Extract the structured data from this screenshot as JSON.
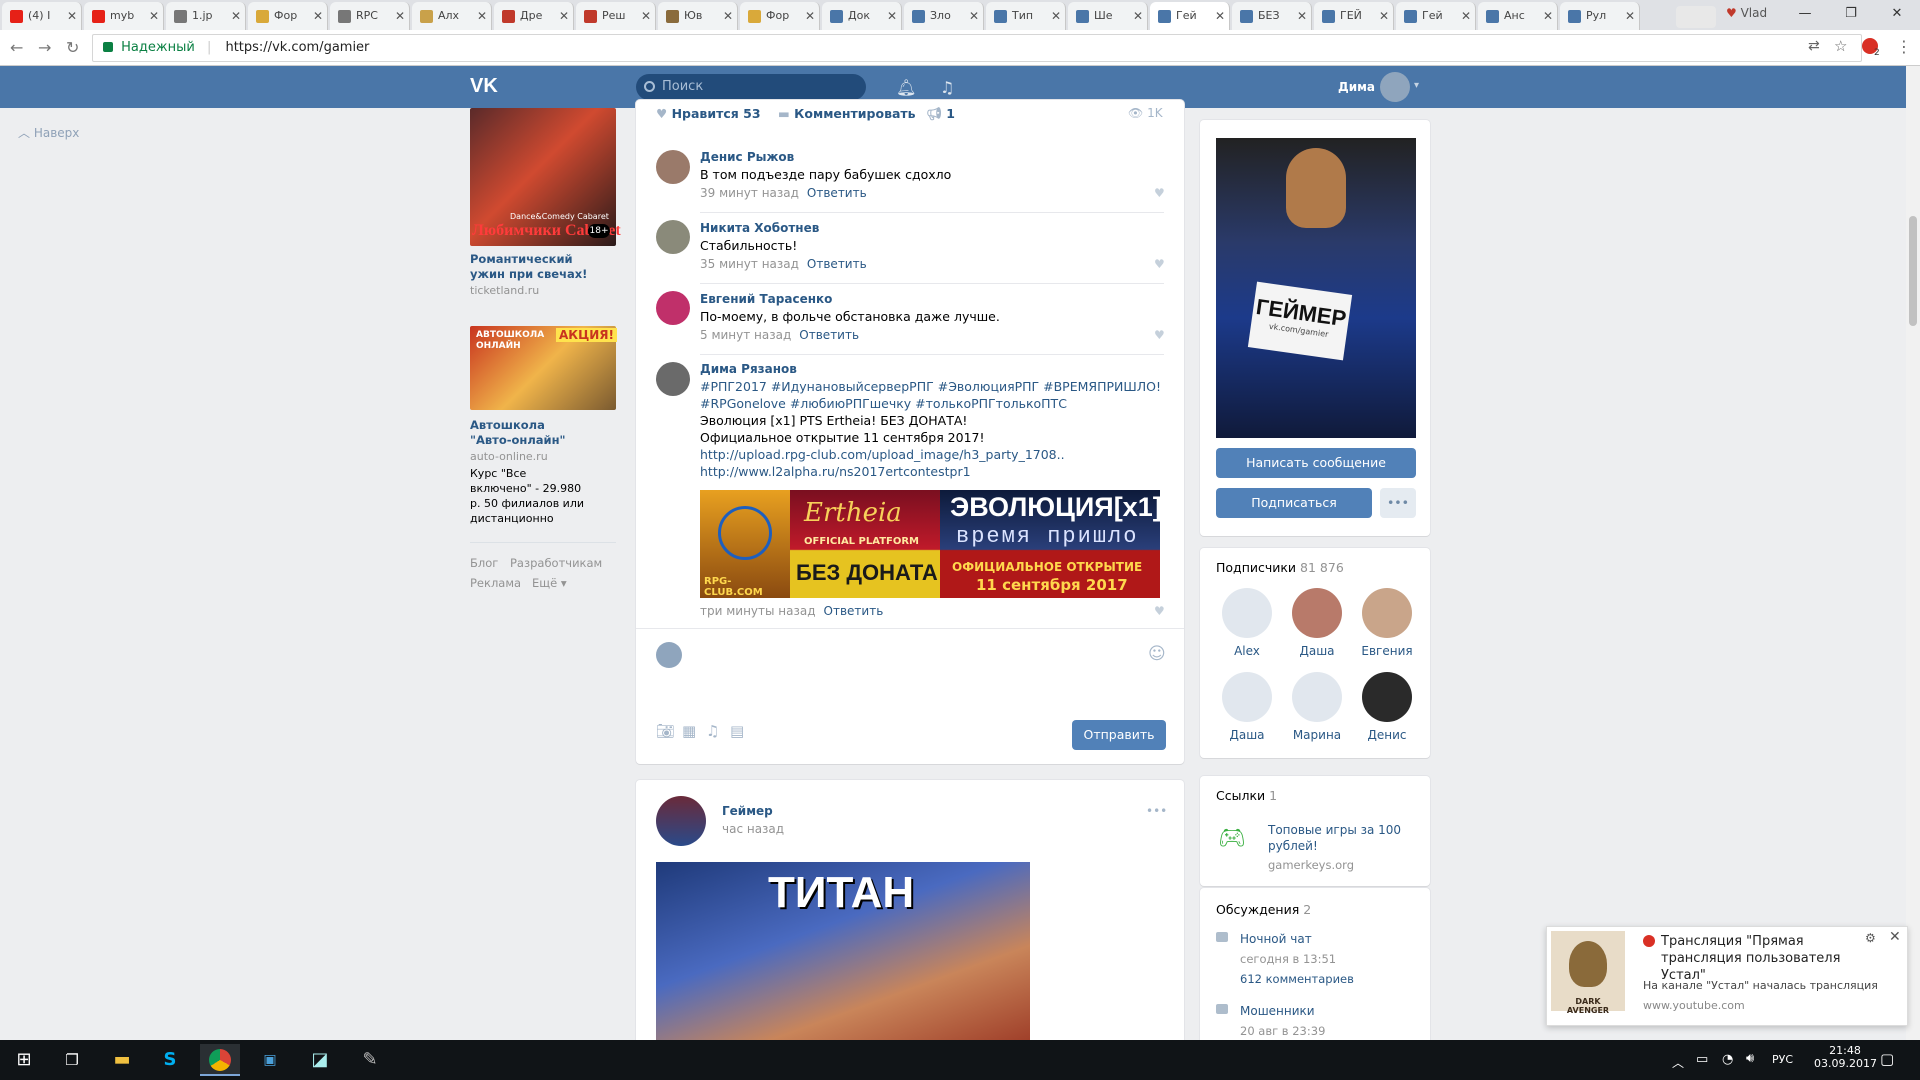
{
  "browser": {
    "tabs": [
      {
        "label": "(4) I",
        "color": "#e62117"
      },
      {
        "label": "myb",
        "color": "#e62117"
      },
      {
        "label": "1.jp",
        "color": "#777"
      },
      {
        "label": "Фор",
        "color": "#d9a93a"
      },
      {
        "label": "RPC",
        "color": "#777"
      },
      {
        "label": "Алх",
        "color": "#c9a14a"
      },
      {
        "label": "Дре",
        "color": "#c0392b"
      },
      {
        "label": "Реш",
        "color": "#c0392b"
      },
      {
        "label": "Юв",
        "color": "#8a6b3c"
      },
      {
        "label": "Фор",
        "color": "#d9a93a"
      },
      {
        "label": "Док",
        "color": "#4a76a8"
      },
      {
        "label": "Зло",
        "color": "#4a76a8"
      },
      {
        "label": "Тип",
        "color": "#4a76a8"
      },
      {
        "label": "Ше",
        "color": "#4a76a8"
      },
      {
        "label": "Гей",
        "color": "#4a76a8"
      },
      {
        "label": "БЕЗ",
        "color": "#4a76a8"
      },
      {
        "label": "ГЕЙ",
        "color": "#4a76a8"
      },
      {
        "label": "Гей",
        "color": "#4a76a8"
      },
      {
        "label": "Анс",
        "color": "#4a76a8"
      },
      {
        "label": "Рул",
        "color": "#4a76a8"
      }
    ],
    "active_tab_index": 14,
    "profile_label": "Vlad",
    "secure_label": "Надежный",
    "url": "https://vk.com/gamier",
    "ext_badge": "2"
  },
  "vk_header": {
    "logo": "VK",
    "search_placeholder": "Поиск",
    "user_name": "Дима"
  },
  "left": {
    "to_top": "Наверх",
    "ads": [
      {
        "title": "Романтический ужин при свечах!",
        "source": "ticketland.ru",
        "image_text": "Любимчики Cabaret",
        "image_badge": "18+",
        "image_caption": "Dance&Comedy Cabaret"
      },
      {
        "title": "Автошкола \"Авто-онлайн\"",
        "source": "auto-online.ru",
        "text": "Курс \"Все включено\" - 29.980 р. 50 филиалов или дистанционно",
        "image_text": "АВТОШКОЛА ОНЛАЙН",
        "image_badge": "АКЦИЯ!"
      }
    ],
    "footer": [
      "Блог",
      "Разработчикам",
      "Реклама",
      "Ещё"
    ]
  },
  "post_bar": {
    "like_label": "Нравится",
    "like_count": "53",
    "comment_label": "Комментировать",
    "share_count": "1",
    "views": "1K"
  },
  "comments": [
    {
      "name": "Денис Рыжов",
      "text": "В том подъезде пару бабушек сдохло",
      "time": "39 минут назад",
      "reply": "Ответить"
    },
    {
      "name": "Никита Хоботнев",
      "text": "Стабильность!",
      "time": "35 минут назад",
      "reply": "Ответить"
    },
    {
      "name": "Евгений Тарасенко",
      "text": "По-моему, в фольче обстановка даже лучше.",
      "time": "5 минут назад",
      "reply": "Ответить"
    },
    {
      "name": "Дима Рязанов",
      "tags1": "#РПГ2017 #ИдунановыйсерверРПГ #ЭволюцияРПГ #ВРЕМЯПРИШЛО!",
      "tags2": "#RPGonelove #любиюРПГшечку #толькоРПГтолькоПТС",
      "line3": "Эволюция [x1] PTS Ertheia! БЕЗ ДОНАТА!",
      "line4": "Официальное открытие 11 сентября 2017!",
      "link1": "http://upload.rpg-club.com/upload_image/h3_party_1708..",
      "link2": "http://www.l2alpha.ru/ns2017ertcontestpr1",
      "banner": {
        "left": "RPG-CLUB.COM",
        "mid_top": "Ertheia",
        "mid_sub": "OFFICIAL PLATFORM",
        "mid_bottom": "БЕЗ ДОНАТА",
        "right_top": "ЭВОЛЮЦИЯ[x1]",
        "right_mid": "время пришло",
        "right_bottom": "ОФИЦИАЛЬНОЕ ОТКРЫТИЕ",
        "right_date": "11 сентября 2017"
      },
      "time": "три минуты назад",
      "reply": "Ответить"
    }
  ],
  "composer": {
    "send_label": "Отправить"
  },
  "post2": {
    "author": "Геймер",
    "time": "час назад",
    "image_text": "ТИТАН",
    "more": "•••"
  },
  "right": {
    "cover_sign": "ГЕЙМЕР",
    "cover_sign_sub": "vk.com/gamier",
    "message_btn": "Написать сообщение",
    "subscribe_btn": "Подписаться",
    "more_btn": "•••",
    "followers_label": "Подписчики",
    "followers_count": "81 876",
    "followers": [
      {
        "name": "Alex",
        "color": "#e1e7ee"
      },
      {
        "name": "Даша",
        "color": "#b87a6a"
      },
      {
        "name": "Евгения",
        "color": "#c9a58a"
      },
      {
        "name": "Даша",
        "color": "#e1e7ee"
      },
      {
        "name": "Марина",
        "color": "#e1e7ee"
      },
      {
        "name": "Денис",
        "color": "#2a2a2a"
      }
    ],
    "links_label": "Ссылки",
    "links_count": "1",
    "link_title": "Топовые игры за 100 рублей!",
    "link_url": "gamerkeys.org",
    "discussions_label": "Обсуждения",
    "discussions_count": "2",
    "discussions": [
      {
        "title": "Ночной чат",
        "date": "сегодня в 13:51",
        "comments": "612 комментариев"
      },
      {
        "title": "Мошенники",
        "date": "20 авг в 23:39"
      }
    ]
  },
  "toast": {
    "title": "Трансляция \"Прямая трансляция пользователя Устал\"",
    "body": "На канале \"Устал\" началась трансляция",
    "source": "www.youtube.com",
    "logo_text": "DARK AVENGER"
  },
  "taskbar": {
    "lang": "РУС",
    "time": "21:48",
    "date": "03.09.2017"
  }
}
